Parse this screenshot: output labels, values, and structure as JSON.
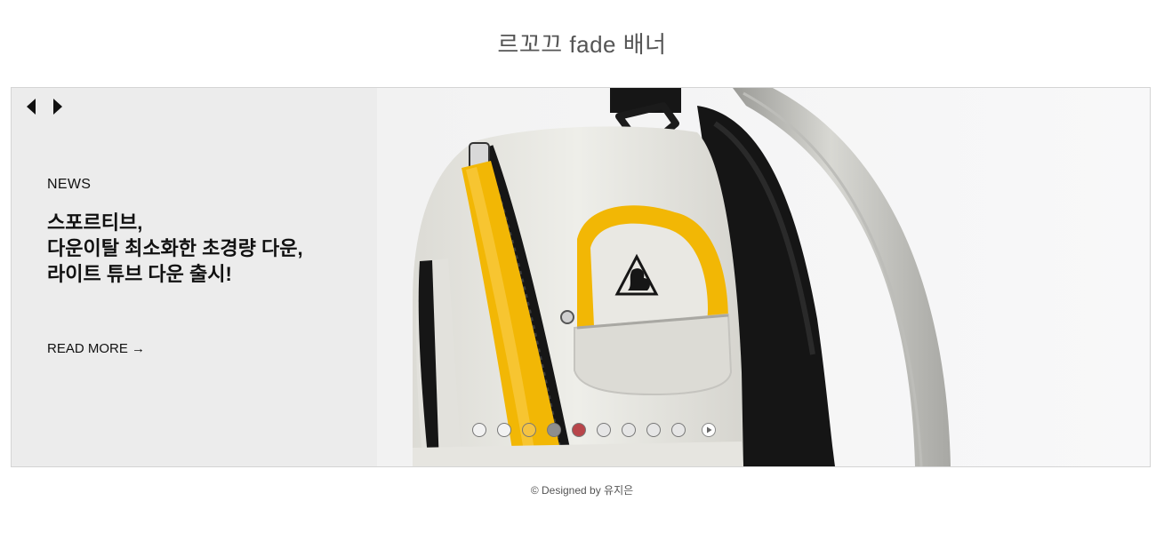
{
  "page": {
    "title": "르꼬끄 fade 배너"
  },
  "banner": {
    "news_label": "NEWS",
    "headline_lines": [
      "스포르티브,",
      "다운이탈 최소화한 초경량 다운,",
      "라이트 튜브 다운 출시!"
    ],
    "read_more": "READ MORE →",
    "image_alt": "르꼬끄 백팩",
    "indicators": {
      "colors": [
        "#f2f2f2",
        "#f2f2f2",
        "#f5c342",
        "#8e8e8e",
        "#b8454a",
        "#e6e6e6",
        "#e6e6e6",
        "#e6e6e6",
        "#e6e6e6"
      ],
      "active_index": 4
    },
    "colors": {
      "panel_bg": "#ececec",
      "photo_bg": "#f4f4f4",
      "accent_yellow": "#f2b705",
      "bag_white": "#e9e8e3",
      "bag_black": "#141414"
    }
  },
  "footer": {
    "text": "© Designed by 유지은"
  }
}
